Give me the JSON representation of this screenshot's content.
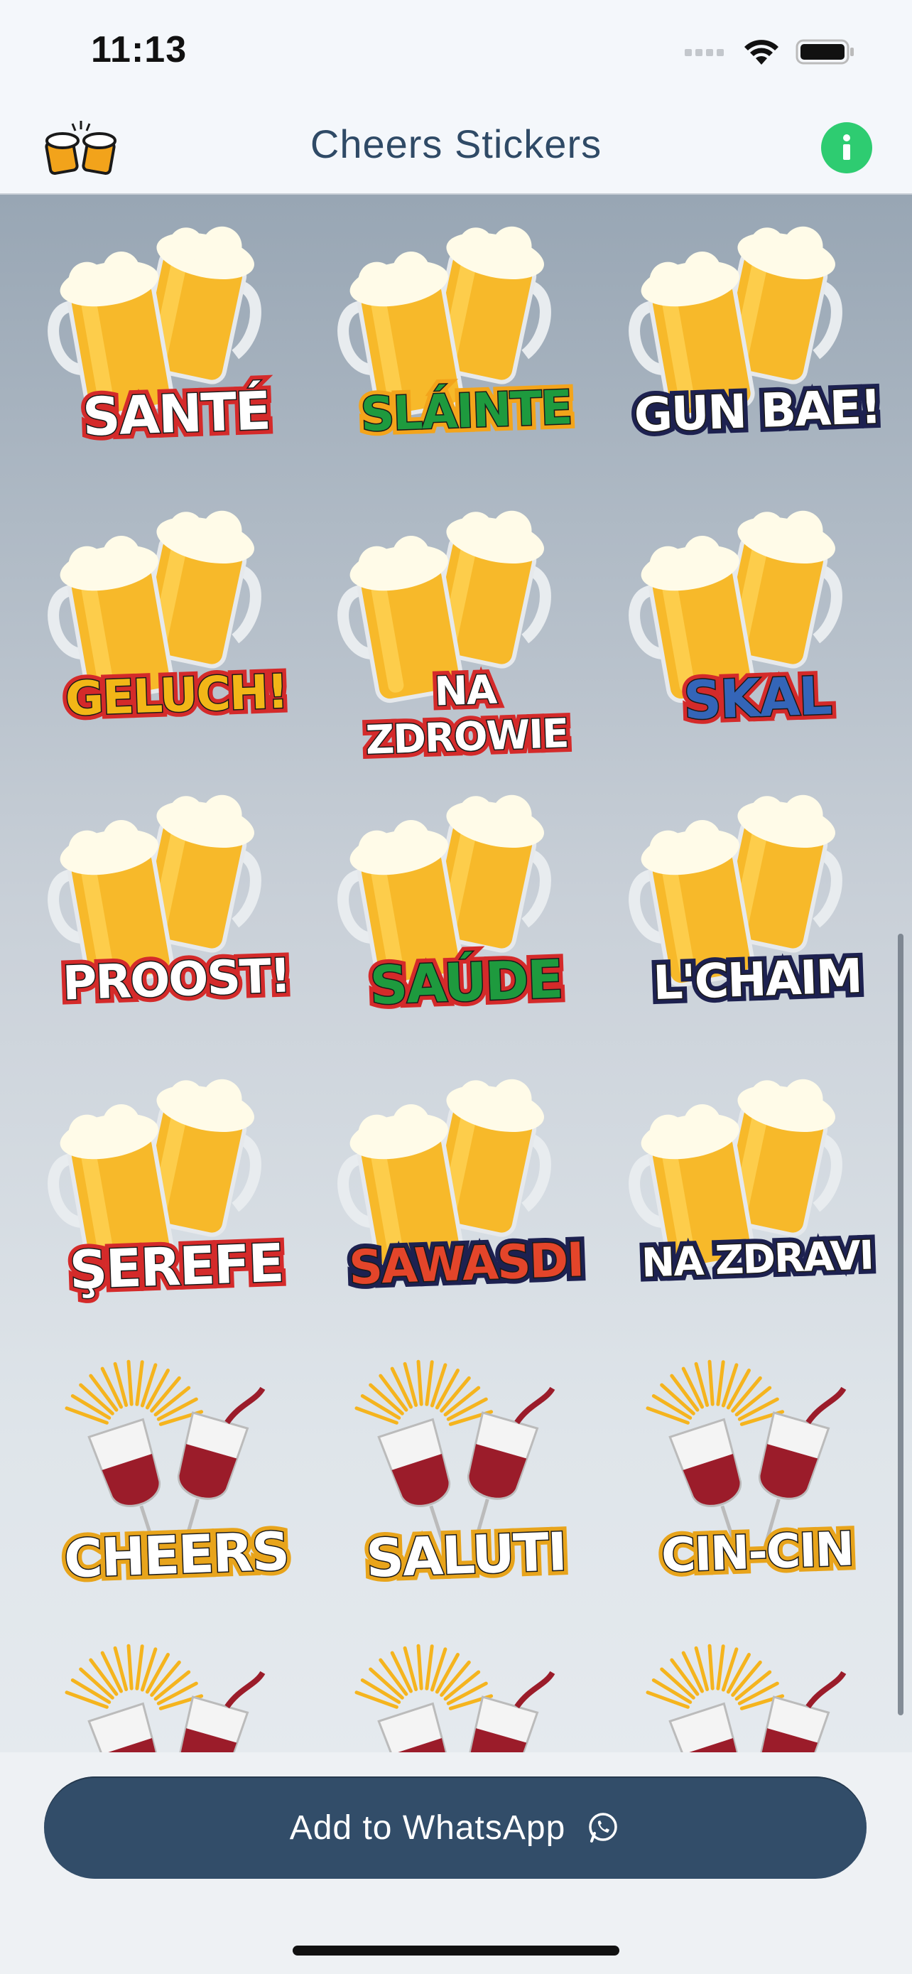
{
  "status": {
    "time": "11:13"
  },
  "nav": {
    "title": "Cheers Stickers"
  },
  "stickers": [
    {
      "label": "SANTÉ",
      "fill": "#ffffff",
      "stroke": "#d42a2a",
      "type": "beer"
    },
    {
      "label": "SLÁINTE",
      "fill": "#1e9a3e",
      "stroke": "#f3a41b",
      "type": "beer"
    },
    {
      "label": "GUN BAE!",
      "fill": "#ffffff",
      "stroke": "#1d2150",
      "type": "beer"
    },
    {
      "label": "GELUCH!",
      "fill": "#f2b617",
      "stroke": "#d42a2a",
      "type": "beer"
    },
    {
      "label": "NA ZDROWIE",
      "fill": "#ffffff",
      "stroke": "#d42a2a",
      "type": "beer"
    },
    {
      "label": "SKAL",
      "fill": "#3465b8",
      "stroke": "#d42a2a",
      "type": "beer"
    },
    {
      "label": "PROOST!",
      "fill": "#ffffff",
      "stroke": "#d42a2a",
      "type": "beer"
    },
    {
      "label": "SAÚDE",
      "fill": "#1e9a3e",
      "stroke": "#d42a2a",
      "type": "beer"
    },
    {
      "label": "L'CHAIM",
      "fill": "#ffffff",
      "stroke": "#1d2150",
      "type": "beer"
    },
    {
      "label": "ŞEREFE",
      "fill": "#ffffff",
      "stroke": "#d42a2a",
      "type": "beer"
    },
    {
      "label": "SAWASDI",
      "fill": "#e4452a",
      "stroke": "#1d2150",
      "type": "beer"
    },
    {
      "label": "NA ZDRAVI",
      "fill": "#ffffff",
      "stroke": "#1d2150",
      "type": "beer"
    },
    {
      "label": "CHEERS",
      "fill": "#ffffff",
      "stroke": "#e8a41b",
      "type": "wine"
    },
    {
      "label": "SALUTI",
      "fill": "#ffffff",
      "stroke": "#e8a41b",
      "type": "wine"
    },
    {
      "label": "CIN-CIN",
      "fill": "#ffffff",
      "stroke": "#e8a41b",
      "type": "wine"
    },
    {
      "label": "",
      "fill": "#ffffff",
      "stroke": "#e8a41b",
      "type": "wine"
    },
    {
      "label": "",
      "fill": "#ffffff",
      "stroke": "#e8a41b",
      "type": "wine"
    },
    {
      "label": "",
      "fill": "#ffffff",
      "stroke": "#e8a41b",
      "type": "wine"
    }
  ],
  "footer": {
    "add_button_label": "Add to WhatsApp"
  },
  "icons": {
    "logo": "cheers-beer-logo-icon",
    "info": "info-icon",
    "whatsapp": "whatsapp-icon",
    "wifi": "wifi-icon",
    "battery": "battery-icon",
    "signal": "cellular-signal-icon"
  },
  "colors": {
    "nav_title": "#2f4a66",
    "info_button": "#2ecc71",
    "add_button": "#324d69"
  }
}
